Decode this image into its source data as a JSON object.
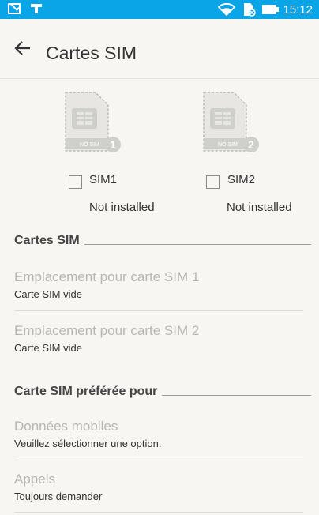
{
  "status_bar": {
    "time": "15:12",
    "icons": [
      "mail-icon",
      "tool-icon",
      "wifi-icon",
      "sim-status-icon",
      "battery-icon"
    ],
    "background": "#0aa5e6"
  },
  "app_bar": {
    "back_icon": "arrow-left-icon",
    "title": "Cartes SIM"
  },
  "sim_slots": [
    {
      "badge_text": "NO SIM",
      "number": "1",
      "label": "SIM1",
      "status": "Not installed",
      "checked": false
    },
    {
      "badge_text": "NO SIM",
      "number": "2",
      "label": "SIM2",
      "status": "Not installed",
      "checked": false
    }
  ],
  "sections": {
    "sim_cards_header": "Cartes SIM",
    "preferred_header": "Carte SIM préférée pour"
  },
  "sim_items": [
    {
      "title": "Emplacement pour carte SIM 1",
      "summary": "Carte SIM vide"
    },
    {
      "title": "Emplacement pour carte SIM 2",
      "summary": "Carte SIM vide"
    }
  ],
  "preferred_items": [
    {
      "title": "Données mobiles",
      "summary": "Veuillez sélectionner une option."
    },
    {
      "title": "Appels",
      "summary": "Toujours demander"
    }
  ]
}
